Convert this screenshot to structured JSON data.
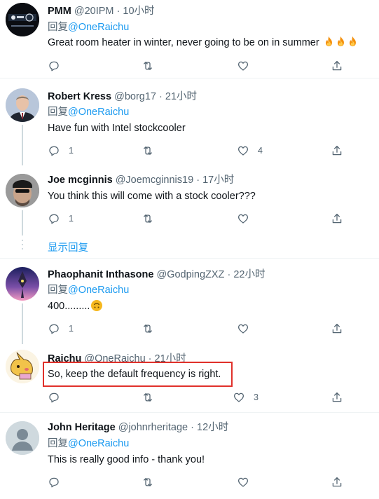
{
  "reply_prefix": "回复",
  "tweets": [
    {
      "name": "PMM",
      "handle": "@20IPM",
      "time": "10小时",
      "reply_to": "@OneRaichu",
      "text": "Great room heater in winter, never going to be on in summer",
      "counts": {
        "reply": "",
        "retweet": "",
        "like": ""
      }
    },
    {
      "name": "Robert Kress",
      "handle": "@borg17",
      "time": "21小时",
      "reply_to": "@OneRaichu",
      "text": "Have fun with Intel stockcooler",
      "counts": {
        "reply": "1",
        "retweet": "",
        "like": "4"
      }
    },
    {
      "name": "Joe mcginnis",
      "handle": "@Joemcginnis19",
      "time": "17小时",
      "reply_to": "",
      "text": "You think this will come with a stock cooler???",
      "counts": {
        "reply": "1",
        "retweet": "",
        "like": ""
      }
    },
    {
      "name": "Phaophanit Inthasone",
      "handle": "@GodpingZXZ",
      "time": "22小时",
      "reply_to": "@OneRaichu",
      "text": "400.........",
      "counts": {
        "reply": "1",
        "retweet": "",
        "like": ""
      }
    },
    {
      "name": "Raichu",
      "handle": "@OneRaichu",
      "time": "21小时",
      "reply_to": "",
      "text": "So, keep the default frequency is right.",
      "counts": {
        "reply": "",
        "retweet": "",
        "like": "3"
      }
    },
    {
      "name": "John Heritage",
      "handle": "@johnrheritage",
      "time": "12小时",
      "reply_to": "@OneRaichu",
      "text": "This is really good info - thank you!",
      "counts": {
        "reply": "",
        "retweet": "",
        "like": ""
      }
    }
  ],
  "show_replies_label": "显示回复",
  "colors": {
    "accent": "#1d9bf0",
    "highlight": "#e0302a",
    "muted": "#536471"
  }
}
